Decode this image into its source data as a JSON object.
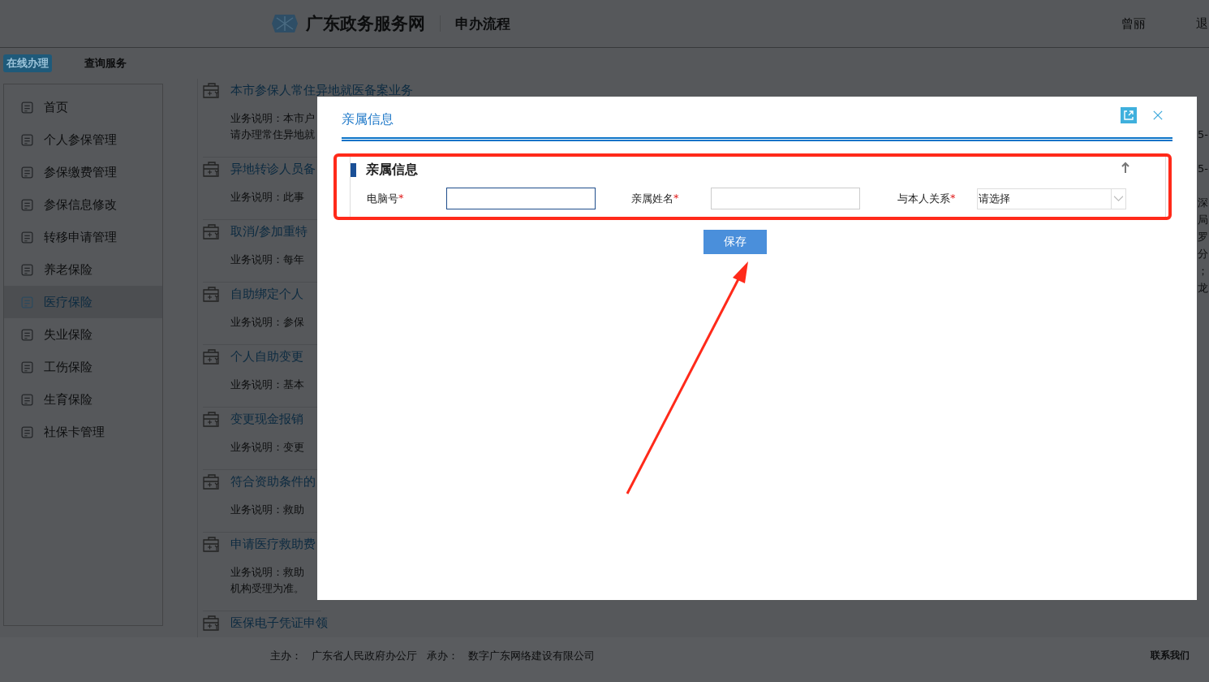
{
  "header": {
    "logo_text": "广东政务服务网",
    "subtitle": "申办流程",
    "user": "曾丽",
    "logout": "退"
  },
  "tabs": [
    {
      "label": "在线办理",
      "selected": true
    },
    {
      "label": "查询服务",
      "selected": false
    }
  ],
  "sidebar": {
    "items": [
      {
        "label": "首页",
        "selected": false
      },
      {
        "label": "个人参保管理",
        "selected": false
      },
      {
        "label": "参保缴费管理",
        "selected": false
      },
      {
        "label": "参保信息修改",
        "selected": false
      },
      {
        "label": "转移申请管理",
        "selected": false
      },
      {
        "label": "养老保险",
        "selected": false
      },
      {
        "label": "医疗保险",
        "selected": true
      },
      {
        "label": "失业保险",
        "selected": false
      },
      {
        "label": "工伤保险",
        "selected": false
      },
      {
        "label": "生育保险",
        "selected": false
      },
      {
        "label": "社保卡管理",
        "selected": false
      }
    ]
  },
  "services": [
    {
      "title": "本市参保人常住异地就医备案业务",
      "description": [
        "业务说明：本市户",
        "请办理常住异地就"
      ]
    },
    {
      "title": "异地转诊人员备",
      "description": [
        "业务说明：此事"
      ]
    },
    {
      "title": "取消/参加重特",
      "description": [
        "业务说明：每年"
      ]
    },
    {
      "title": "自助绑定个人",
      "description": [
        "业务说明：参保"
      ]
    },
    {
      "title": "个人自助变更",
      "description": [
        "业务说明：基本"
      ]
    },
    {
      "title": "变更现金报销",
      "description": [
        "业务说明：变更"
      ]
    },
    {
      "title": "符合资助条件的",
      "description": [
        "业务说明：救助"
      ]
    },
    {
      "title": "申请医疗救助费",
      "description": [
        "业务说明：救助",
        "机构受理为准。"
      ]
    },
    {
      "title": "医保电子凭证申领"
    }
  ],
  "right_column": [
    "5-",
    "5-",
    "深",
    "局",
    "罗",
    "分",
    "；",
    "龙"
  ],
  "footer": {
    "sponsor_label": "主办：",
    "sponsor": "广东省人民政府办公厅",
    "organizer_label": "承办：",
    "organizer": "数字广东网络建设有限公司",
    "contact": "联系我们"
  },
  "dialog": {
    "title": "亲属信息",
    "section_title": "亲属信息",
    "fields": [
      {
        "label": "电脑号",
        "required": true,
        "kind": "text",
        "focused": true
      },
      {
        "label": "亲属姓名",
        "required": true,
        "kind": "text",
        "focused": false
      },
      {
        "label": "与本人关系",
        "required": true,
        "kind": "select",
        "value": "请选择"
      }
    ],
    "required_mark": "*",
    "save_button": "保存"
  },
  "annotation": {
    "highlight_box": true,
    "arrow": true
  }
}
